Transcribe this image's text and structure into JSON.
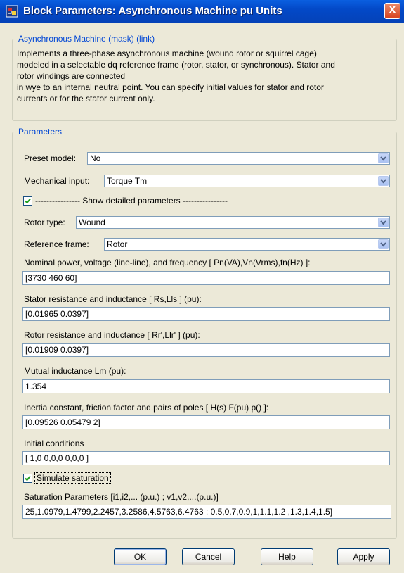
{
  "window": {
    "title": "Block Parameters: Asynchronous Machine pu Units",
    "close_label": "X"
  },
  "mask": {
    "group_title": "Asynchronous Machine (mask) (link)",
    "description_lines": [
      "Implements a three-phase asynchronous machine (wound rotor or squirrel cage)",
      "modeled in a selectable dq reference frame (rotor, stator, or synchronous). Stator and",
      "rotor windings are connected",
      "in wye to an internal neutral point. You can specify initial values for stator and rotor",
      "currents or for  the stator current only."
    ]
  },
  "parameters": {
    "group_title": "Parameters",
    "preset_model": {
      "label": "Preset model:",
      "value": "No"
    },
    "mechanical_input": {
      "label": "Mechanical input:",
      "value": "Torque Tm"
    },
    "show_detailed": {
      "label": "---------------- Show detailed parameters ----------------",
      "checked": true
    },
    "rotor_type": {
      "label": "Rotor type:",
      "value": "Wound"
    },
    "reference_frame": {
      "label": "Reference frame:",
      "value": "Rotor"
    },
    "nominal": {
      "label": "Nominal power, voltage (line-line), and frequency  [ Pn(VA),Vn(Vrms),fn(Hz) ]:",
      "value": "[3730 460 60]"
    },
    "stator": {
      "label": "Stator resistance and inductance  [ Rs,Lls ] (pu):",
      "value": "[0.01965 0.0397]"
    },
    "rotor": {
      "label": "Rotor resistance and inductance  [ Rr',Llr' ] (pu):",
      "value": "[0.01909 0.0397]"
    },
    "mutual": {
      "label": "Mutual inductance Lm (pu):",
      "value": "1.354"
    },
    "inertia": {
      "label": "Inertia constant, friction factor and pairs of poles [ H(s) F(pu) p() ]:",
      "value": "[0.09526 0.05479 2]"
    },
    "initial": {
      "label": "Initial conditions",
      "value": "[ 1,0  0,0,0  0,0,0 ]"
    },
    "saturation": {
      "label": "Simulate saturation",
      "checked": true
    },
    "saturation_params": {
      "label": "Saturation Parameters [i1,i2,... (p.u.) ; v1,v2,...(p.u.)]",
      "value": "25,1.0979,1.4799,2.2457,3.2586,4.5763,6.4763 ;  0.5,0.7,0.9,1,1.1,1.2 ,1.3,1.4,1.5]"
    }
  },
  "buttons": {
    "ok": "OK",
    "cancel": "Cancel",
    "help": "Help",
    "apply": "Apply"
  },
  "colors": {
    "title_bar": "#0349c8",
    "group_title": "#0046d5",
    "dialog_bg": "#ece9d8"
  }
}
